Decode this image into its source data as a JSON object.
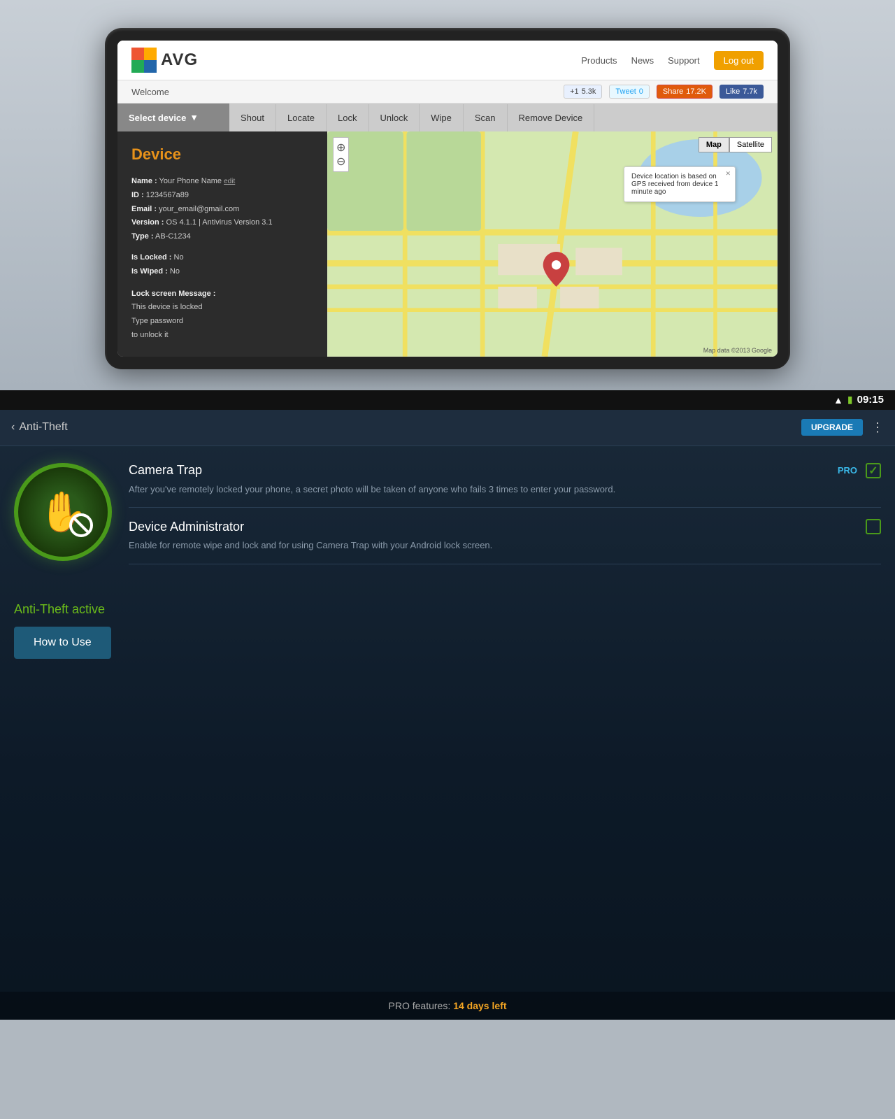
{
  "tablet": {
    "header": {
      "logo_text": "AVG",
      "nav_products": "Products",
      "nav_news": "News",
      "nav_support": "Support",
      "logout_label": "Log out"
    },
    "social": {
      "welcome": "Welcome",
      "gplus_label": "+1",
      "gplus_count": "5.3k",
      "tweet_label": "Tweet",
      "tweet_count": "0",
      "share_label": "Share",
      "share_count": "17.2K",
      "like_label": "Like",
      "like_count": "7.7k"
    },
    "toolbar": {
      "select_device": "Select device",
      "items": [
        "Shout",
        "Locate",
        "Lock",
        "Unlock",
        "Wipe",
        "Scan",
        "Remove Device"
      ]
    },
    "device": {
      "title": "Device",
      "name_label": "Name :",
      "name_value": "Your Phone Name",
      "edit_label": "edit",
      "id_label": "ID :",
      "id_value": "1234567a89",
      "email_label": "Email :",
      "email_value": "your_email@gmail.com",
      "version_label": "Version :",
      "version_value": "OS 4.1.1 | Antivirus Version 3.1",
      "type_label": "Type :",
      "type_value": "AB-C1234",
      "locked_label": "Is Locked :",
      "locked_value": "No",
      "wiped_label": "Is Wiped :",
      "wiped_value": "No",
      "lock_screen_label": "Lock screen Message :",
      "lock_screen_msg": "This device is locked\nType password\nto unlock it"
    },
    "map": {
      "map_btn": "Map",
      "satellite_btn": "Satellite",
      "tooltip": "Device location is based on GPS received from device 1 minute ago",
      "attribution": "Map data ©2013 Google"
    }
  },
  "android": {
    "status_bar": {
      "time": "09:15"
    },
    "toolbar": {
      "back_label": "Anti-Theft",
      "upgrade_label": "UPGRADE"
    },
    "camera_trap": {
      "title": "Camera Trap",
      "pro_label": "PRO",
      "desc": "After you've remotely locked your phone, a secret photo will be taken of anyone who fails 3 times to enter your password.",
      "checked": true
    },
    "device_admin": {
      "title": "Device Administrator",
      "desc": "Enable for remote wipe and lock and for using Camera Trap with your Android lock screen.",
      "checked": false
    },
    "bottom": {
      "active_label": "Anti-Theft active",
      "how_to_use": "How to Use"
    },
    "pro_bar": {
      "label": "PRO features:",
      "days": "14 days left"
    }
  }
}
